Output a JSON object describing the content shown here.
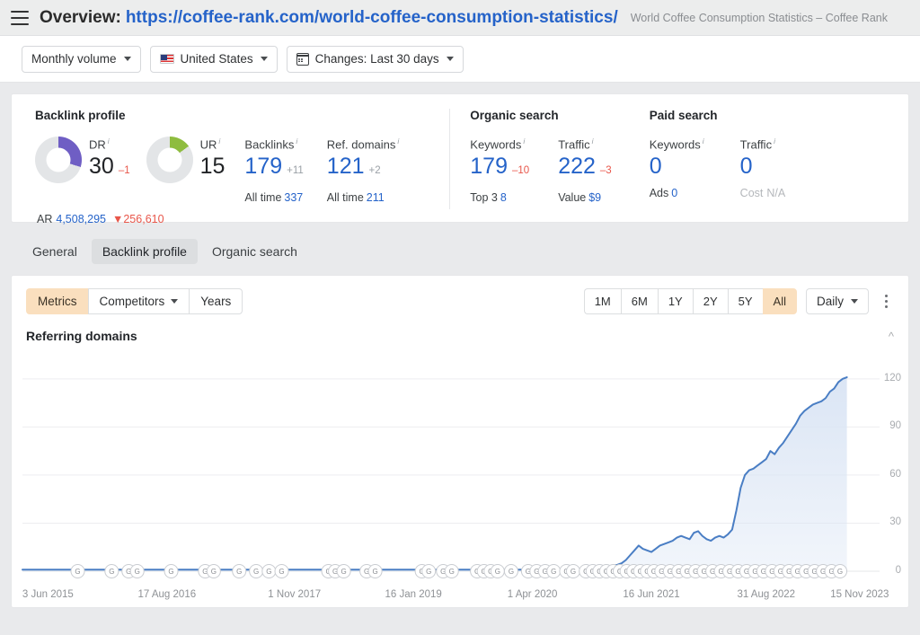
{
  "header": {
    "menu_icon": "hamburger-icon",
    "title": "Overview:",
    "url": "https://coffee-rank.com/world-coffee-consumption-statistics/",
    "subtitle": "World Coffee Consumption Statistics – Coffee Rank"
  },
  "filters": [
    {
      "id": "mode",
      "label": "Monthly volume",
      "icon": "none"
    },
    {
      "id": "country",
      "label": "United States",
      "icon": "us-flag-icon"
    },
    {
      "id": "changes",
      "label": "Changes: Last 30 days",
      "icon": "calendar-icon"
    }
  ],
  "metrics": {
    "backlink_profile": {
      "title": "Backlink profile",
      "dr": {
        "label": "DR",
        "value": "30",
        "delta": "–1",
        "delta_sign": "neg",
        "percent": 30,
        "color": "#6f5ec4"
      },
      "ur": {
        "label": "UR",
        "value": "15",
        "delta": "",
        "delta_sign": "",
        "percent": 15,
        "color": "#8ebc3f"
      },
      "backlinks": {
        "label": "Backlinks",
        "value": "179",
        "delta": "+11",
        "delta_sign": "pos",
        "sub_label": "All time",
        "sub_value": "337"
      },
      "ref_domains": {
        "label": "Ref. domains",
        "value": "121",
        "delta": "+2",
        "delta_sign": "pos",
        "sub_label": "All time",
        "sub_value": "211"
      },
      "ar": {
        "label": "AR",
        "value": "4,508,295",
        "delta": "256,610",
        "delta_arrow": "▼"
      }
    },
    "organic_search": {
      "title": "Organic search",
      "keywords": {
        "label": "Keywords",
        "value": "179",
        "delta": "–10",
        "delta_sign": "neg",
        "sub_label": "Top 3",
        "sub_value": "8"
      },
      "traffic": {
        "label": "Traffic",
        "value": "222",
        "delta": "–3",
        "delta_sign": "neg",
        "sub_label": "Value",
        "sub_value": "$9"
      }
    },
    "paid_search": {
      "title": "Paid search",
      "keywords": {
        "label": "Keywords",
        "value": "0",
        "delta": "",
        "delta_sign": "",
        "sub_label": "Ads",
        "sub_value": "0"
      },
      "traffic": {
        "label": "Traffic",
        "value": "0",
        "delta": "",
        "delta_sign": "",
        "sub_label": "Cost",
        "sub_value": "N/A"
      }
    }
  },
  "tabs": [
    {
      "label": "General",
      "active": false
    },
    {
      "label": "Backlink profile",
      "active": true
    },
    {
      "label": "Organic search",
      "active": false
    }
  ],
  "chart_controls": {
    "left_segments": [
      {
        "label": "Metrics",
        "selected": true,
        "caret": false
      },
      {
        "label": "Competitors",
        "selected": false,
        "caret": true
      },
      {
        "label": "Years",
        "selected": false,
        "caret": false
      }
    ],
    "ranges": [
      {
        "label": "1M",
        "selected": false
      },
      {
        "label": "6M",
        "selected": false
      },
      {
        "label": "1Y",
        "selected": false
      },
      {
        "label": "2Y",
        "selected": false
      },
      {
        "label": "5Y",
        "selected": false
      },
      {
        "label": "All",
        "selected": true
      }
    ],
    "granularity": {
      "label": "Daily",
      "caret": true
    },
    "more_icon": "kebab-menu-icon"
  },
  "chart_panel": {
    "title": "Referring domains",
    "collapse_icon": "chevron-up-icon"
  },
  "chart_data": {
    "type": "area",
    "title": "Referring domains",
    "xlabel": "",
    "ylabel": "",
    "ylim": [
      0,
      130
    ],
    "yticks": [
      30,
      60,
      90,
      120
    ],
    "grid": true,
    "legend_position": "none",
    "line_color": "#4a7ec4",
    "fill_color": "#d9e4f4",
    "xticks": [
      "3 Jun 2015",
      "17 Aug 2016",
      "1 Nov 2017",
      "16 Jan 2019",
      "1 Apr 2020",
      "16 Jun 2021",
      "31 Aug 2022",
      "15 Nov 2023"
    ],
    "xtick_positions": [
      0.03,
      0.17,
      0.32,
      0.46,
      0.6,
      0.74,
      0.875,
      0.985
    ],
    "annotation_markers": {
      "label": "G",
      "meaning": "google-algorithm-update",
      "count": 60
    },
    "x": [
      0.0,
      0.03,
      0.06,
      0.09,
      0.12,
      0.15,
      0.18,
      0.21,
      0.24,
      0.27,
      0.3,
      0.33,
      0.36,
      0.39,
      0.42,
      0.45,
      0.48,
      0.51,
      0.54,
      0.57,
      0.6,
      0.63,
      0.66,
      0.675,
      0.69,
      0.7,
      0.705,
      0.71,
      0.715,
      0.72,
      0.725,
      0.73,
      0.735,
      0.74,
      0.745,
      0.75,
      0.755,
      0.76,
      0.765,
      0.77,
      0.775,
      0.78,
      0.785,
      0.79,
      0.795,
      0.8,
      0.805,
      0.81,
      0.815,
      0.82,
      0.825,
      0.83,
      0.835,
      0.84,
      0.845,
      0.85,
      0.855,
      0.86,
      0.865,
      0.87,
      0.875,
      0.88,
      0.885,
      0.89,
      0.895,
      0.9,
      0.905,
      0.91,
      0.915,
      0.92,
      0.925,
      0.93,
      0.935,
      0.94,
      0.945,
      0.95,
      0.955,
      0.96,
      0.965,
      0.97
    ],
    "values": [
      1,
      1,
      1,
      1,
      1,
      1,
      1,
      1,
      1,
      1,
      1,
      1,
      1,
      1,
      1,
      1,
      1,
      1,
      1,
      1,
      1,
      1,
      1,
      2,
      3,
      4,
      5,
      7,
      10,
      13,
      16,
      14,
      13,
      12,
      14,
      16,
      17,
      18,
      19,
      21,
      22,
      21,
      20,
      24,
      25,
      22,
      20,
      19,
      21,
      22,
      21,
      23,
      26,
      38,
      52,
      60,
      63,
      64,
      66,
      68,
      70,
      75,
      73,
      77,
      80,
      84,
      88,
      92,
      97,
      100,
      102,
      104,
      105,
      106,
      108,
      112,
      114,
      118,
      120,
      121
    ],
    "last_value": 121
  }
}
